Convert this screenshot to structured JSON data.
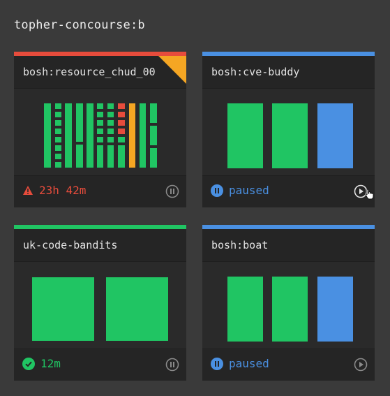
{
  "team": {
    "name": "topher-concourse:b"
  },
  "colors": {
    "failed": "#e74c3c",
    "paused": "#4a90e2",
    "succeeded": "#20c563",
    "pending": "#f5a623",
    "background": "#3a3a3a",
    "card": "#2a2a2a"
  },
  "pipelines": [
    {
      "name": "bosh:resource_chud_00",
      "status_color": "failed",
      "has_running_corner": true,
      "status_icon": "warning-icon",
      "status_text": "23h 42m",
      "control_icon": "pause-icon"
    },
    {
      "name": "bosh:cve-buddy",
      "status_color": "paused",
      "status_icon": "paused-icon",
      "status_text": "paused",
      "control_icon": "play-icon"
    },
    {
      "name": "uk-code-bandits",
      "status_color": "succeeded",
      "status_icon": "check-circle-icon",
      "status_text": "12m",
      "control_icon": "pause-icon"
    },
    {
      "name": "bosh:boat",
      "status_color": "paused",
      "status_icon": "paused-icon",
      "status_text": "paused",
      "control_icon": "play-icon"
    }
  ]
}
